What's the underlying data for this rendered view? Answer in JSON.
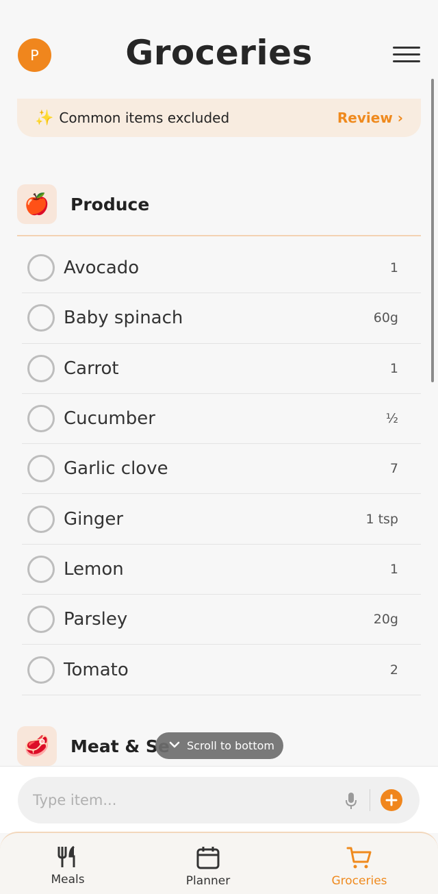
{
  "header": {
    "avatar_initial": "P",
    "title": "Groceries"
  },
  "banner": {
    "icon": "sparkles-icon",
    "text": "Common items excluded",
    "action": "Review ›"
  },
  "categories": [
    {
      "icon": "apple-icon",
      "emoji": "🍎",
      "label": "Produce"
    },
    {
      "icon": "meat-icon",
      "emoji": "🥩",
      "label": "Meat & Se"
    }
  ],
  "items": [
    {
      "name": "Avocado",
      "qty": "1"
    },
    {
      "name": "Baby spinach",
      "qty": "60g"
    },
    {
      "name": "Carrot",
      "qty": "1"
    },
    {
      "name": "Cucumber",
      "qty": "½"
    },
    {
      "name": "Garlic clove",
      "qty": "7"
    },
    {
      "name": "Ginger",
      "qty": "1 tsp"
    },
    {
      "name": "Lemon",
      "qty": "1"
    },
    {
      "name": "Parsley",
      "qty": "20g"
    },
    {
      "name": "Tomato",
      "qty": "2"
    }
  ],
  "toast": {
    "text": "Scroll to bottom"
  },
  "input": {
    "placeholder": "Type item..."
  },
  "tabs": [
    {
      "label": "Meals",
      "icon": "fork-knife-icon"
    },
    {
      "label": "Planner",
      "icon": "calendar-icon"
    },
    {
      "label": "Groceries",
      "icon": "cart-icon",
      "active": true
    }
  ],
  "colors": {
    "accent": "#ef8a1e",
    "banner_bg": "#f8ece0"
  }
}
